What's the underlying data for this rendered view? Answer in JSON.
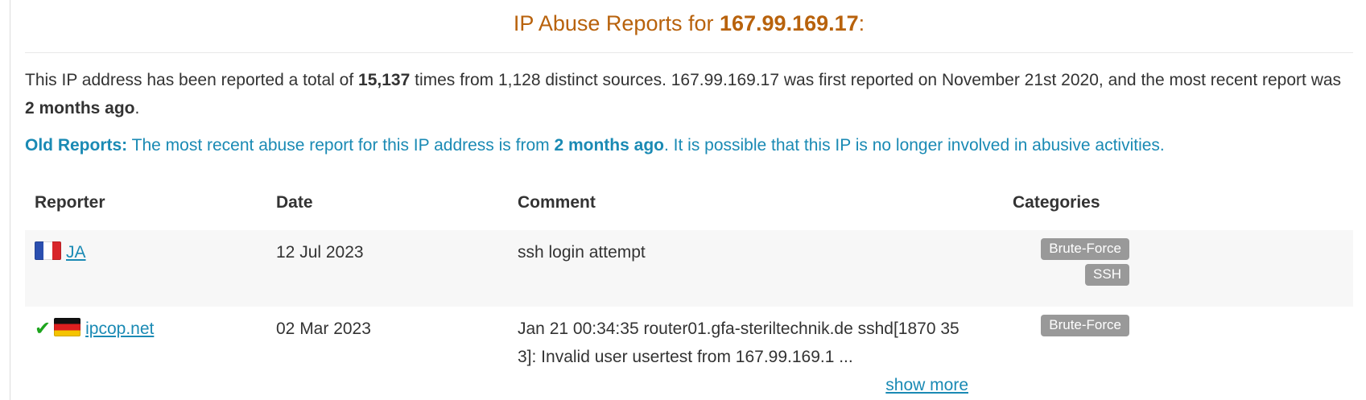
{
  "title": {
    "prefix": "IP Abuse Reports for ",
    "ip": "167.99.169.17",
    "suffix": ":"
  },
  "summary": {
    "part1": "This IP address has been reported a total of ",
    "total": "15,137",
    "part2": " times from 1,128 distinct sources. 167.99.169.17 was first reported on November 21st 2020, and the most recent report was ",
    "recent": "2 months ago",
    "part3": "."
  },
  "old_reports": {
    "label": "Old Reports:",
    "part1": " The most recent abuse report for this IP address is from ",
    "recent": "2 months ago",
    "part2": ". It is possible that this IP is no longer involved in abusive activities."
  },
  "table": {
    "headers": {
      "reporter": "Reporter",
      "date": "Date",
      "comment": "Comment",
      "categories": "Categories"
    },
    "rows": [
      {
        "flag": "flag-france-icon",
        "verified": false,
        "reporter": "JA",
        "date": "12 Jul 2023",
        "comment": "ssh login attempt",
        "categories": [
          "Brute-Force",
          "SSH"
        ]
      },
      {
        "flag": "flag-germany-icon",
        "verified": true,
        "reporter": "ipcop.net",
        "date": "02 Mar 2023",
        "comment": "Jan 21 00:34:35 router01.gfa-steriltechnik.de sshd[1870 353]: Invalid user usertest from 167.99.169.1 ...",
        "show_more": "show more",
        "categories": [
          "Brute-Force"
        ]
      }
    ]
  },
  "colors": {
    "title": "#b8620c",
    "link": "#1a8ab4",
    "badge": "#999999",
    "verified_check": "#1ea51e"
  }
}
